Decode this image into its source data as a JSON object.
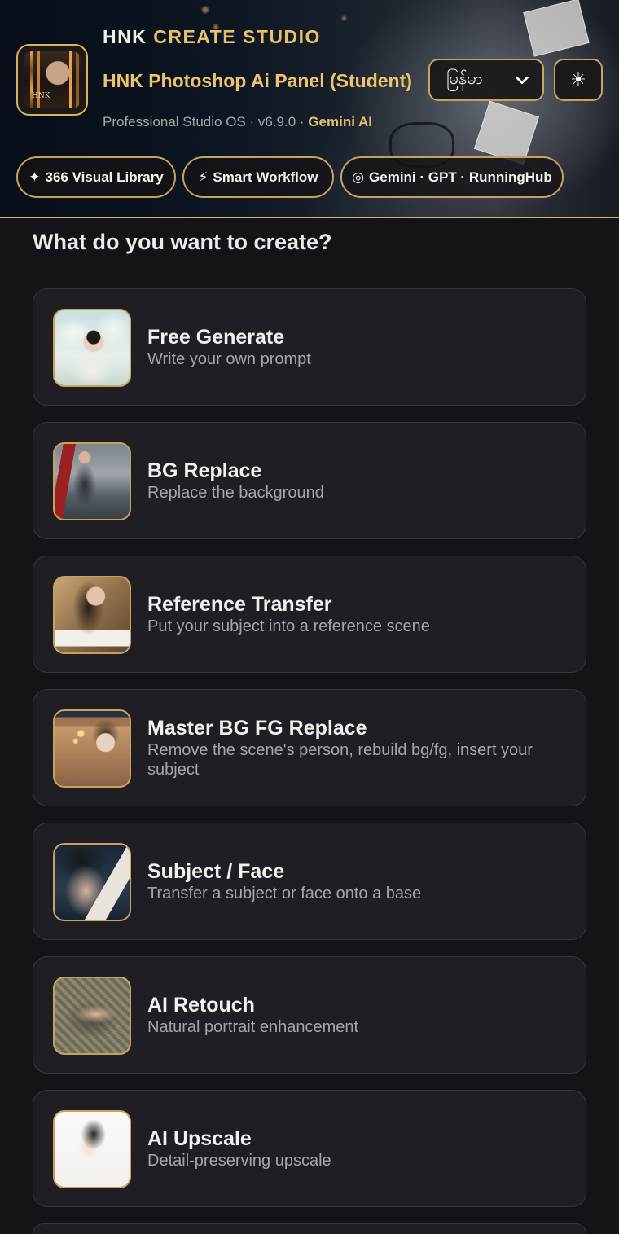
{
  "header": {
    "brand_part1": "HNK",
    "brand_part2": "CREATE STUDIO",
    "app_title": "HNK Photoshop Ai Panel (Student)",
    "meta_text": "Professional Studio OS · v6.9.0 · ",
    "meta_engine": "Gemini AI",
    "language": {
      "selected": "မြန်မာ"
    },
    "theme_toggle_glyph": "☀",
    "chips": [
      {
        "icon": "✦",
        "label": "366 Visual Library"
      },
      {
        "icon": "⚡",
        "label": "Smart Workflow"
      },
      {
        "icon": "◎",
        "label": "Gemini · GPT · RunningHub"
      }
    ]
  },
  "main": {
    "question": "What do you want to create?",
    "modes": [
      {
        "title": "Free Generate",
        "subtitle": "Write your own prompt"
      },
      {
        "title": "BG Replace",
        "subtitle": "Replace the background"
      },
      {
        "title": "Reference Transfer",
        "subtitle": "Put your subject into a reference scene"
      },
      {
        "title": "Master BG FG Replace",
        "subtitle": "Remove the scene's person, rebuild bg/fg, insert your subject"
      },
      {
        "title": "Subject / Face",
        "subtitle": "Transfer a subject or face onto a base"
      },
      {
        "title": "AI Retouch",
        "subtitle": "Natural portrait enhancement"
      },
      {
        "title": "AI Upscale",
        "subtitle": "Detail-preserving upscale"
      }
    ]
  },
  "colors": {
    "accent_gold": "#e8c06a",
    "card_bg": "#1e1e24",
    "page_bg": "#141418"
  }
}
